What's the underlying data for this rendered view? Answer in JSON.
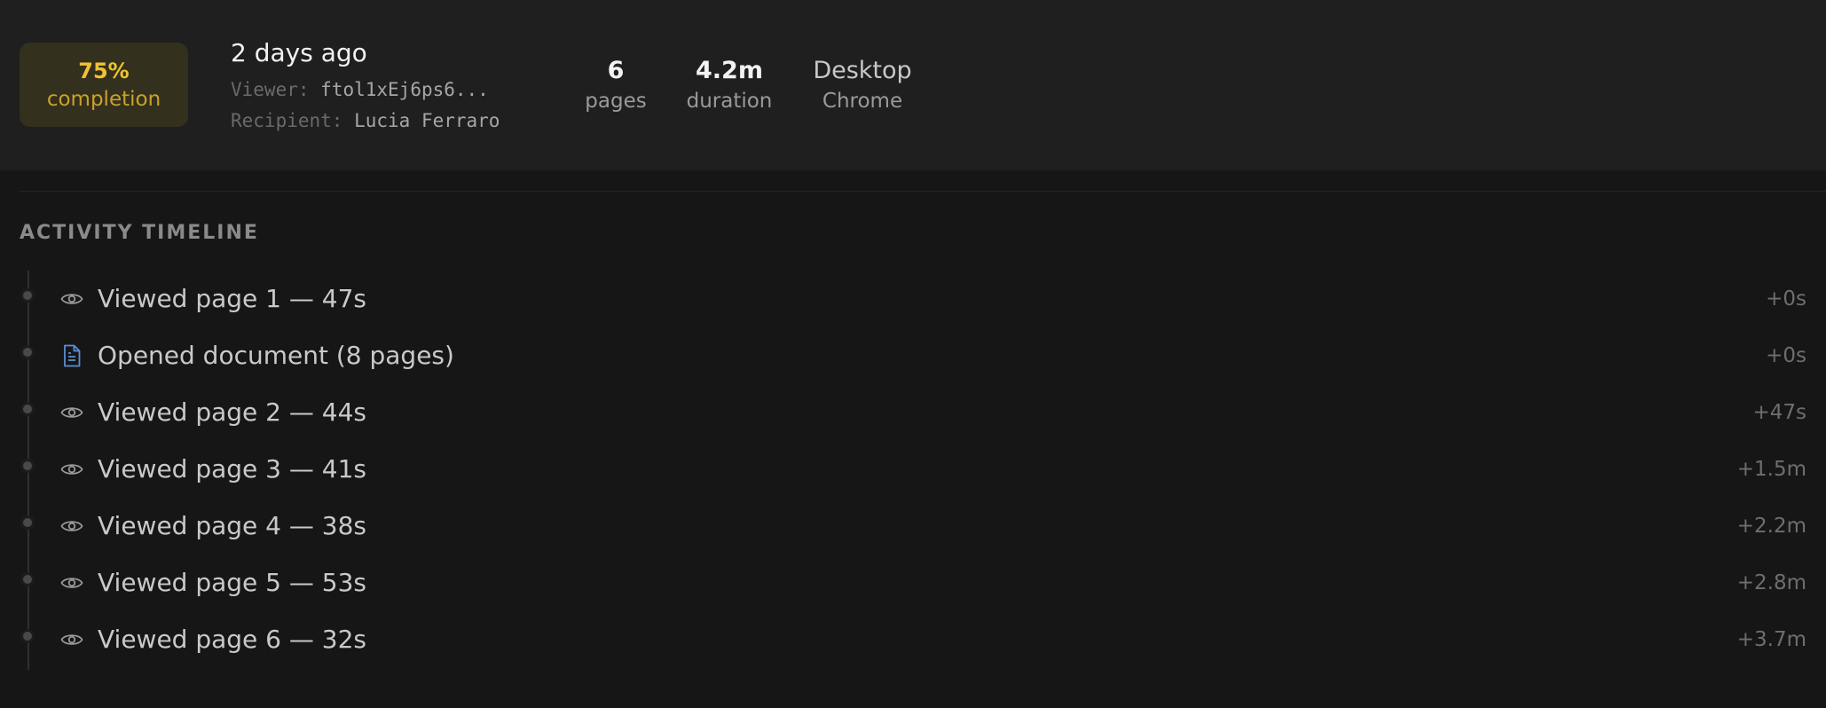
{
  "summary": {
    "completion_pct": "75%",
    "completion_label": "completion",
    "completion_fraction": 0.75,
    "when": "2 days ago",
    "viewer_label": "Viewer:",
    "viewer_value": "ftol1xEj6ps6...",
    "recipient_label": "Recipient:",
    "recipient_value": "Lucia Ferraro",
    "pages_value": "6",
    "pages_label": "pages",
    "duration_value": "4.2m",
    "duration_label": "duration",
    "device": "Desktop",
    "browser": "Chrome"
  },
  "timeline": {
    "title": "ACTIVITY TIMELINE",
    "events": [
      {
        "icon": "eye-icon",
        "text": "Viewed page 1 — 47s",
        "delta": "+0s"
      },
      {
        "icon": "document-icon",
        "text": "Opened document (8 pages)",
        "delta": "+0s"
      },
      {
        "icon": "eye-icon",
        "text": "Viewed page 2 — 44s",
        "delta": "+47s"
      },
      {
        "icon": "eye-icon",
        "text": "Viewed page 3 — 41s",
        "delta": "+1.5m"
      },
      {
        "icon": "eye-icon",
        "text": "Viewed page 4 — 38s",
        "delta": "+2.2m"
      },
      {
        "icon": "eye-icon",
        "text": "Viewed page 5 — 53s",
        "delta": "+2.8m"
      },
      {
        "icon": "eye-icon",
        "text": "Viewed page 6 — 32s",
        "delta": "+3.7m"
      }
    ]
  },
  "colors": {
    "accent": "#f0c230",
    "document_icon": "#5b8fd6"
  }
}
